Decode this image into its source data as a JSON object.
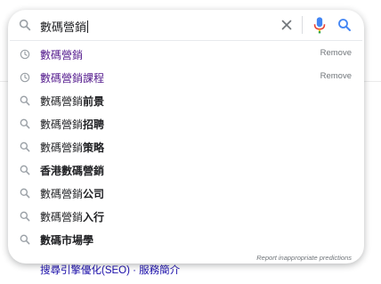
{
  "search": {
    "query": "數碼營銷"
  },
  "suggestions": [
    {
      "typed": "數碼營銷",
      "rest": "",
      "kind": "history",
      "action": "Remove"
    },
    {
      "typed": "數碼營銷",
      "rest": "課程",
      "kind": "history",
      "action": "Remove"
    },
    {
      "typed": "數碼營銷",
      "rest": "前景",
      "kind": "search"
    },
    {
      "typed": "數碼營銷",
      "rest": "招聘",
      "kind": "search"
    },
    {
      "typed": "數碼營銷",
      "rest": "策略",
      "kind": "search"
    },
    {
      "typed": "",
      "rest": "香港數碼營銷",
      "kind": "search"
    },
    {
      "typed": "數碼營銷",
      "rest": "公司",
      "kind": "search"
    },
    {
      "typed": "數碼營銷",
      "rest": "入行",
      "kind": "search"
    },
    {
      "typed": "",
      "rest": "數碼市場學",
      "kind": "search"
    }
  ],
  "report_link": "Report inappropriate predictions",
  "background": {
    "link_text": "搜尋引擎優化(SEO) · 服務簡介"
  },
  "colors": {
    "history_text": "#52188c",
    "mic_blue": "#4285f4",
    "mic_red": "#ea4335",
    "mic_yellow": "#fbbc04",
    "mic_green": "#34a853",
    "search_blue": "#4285f4",
    "link": "#1a0dab"
  },
  "icons": {
    "history": "clock-icon",
    "search": "search-icon"
  }
}
